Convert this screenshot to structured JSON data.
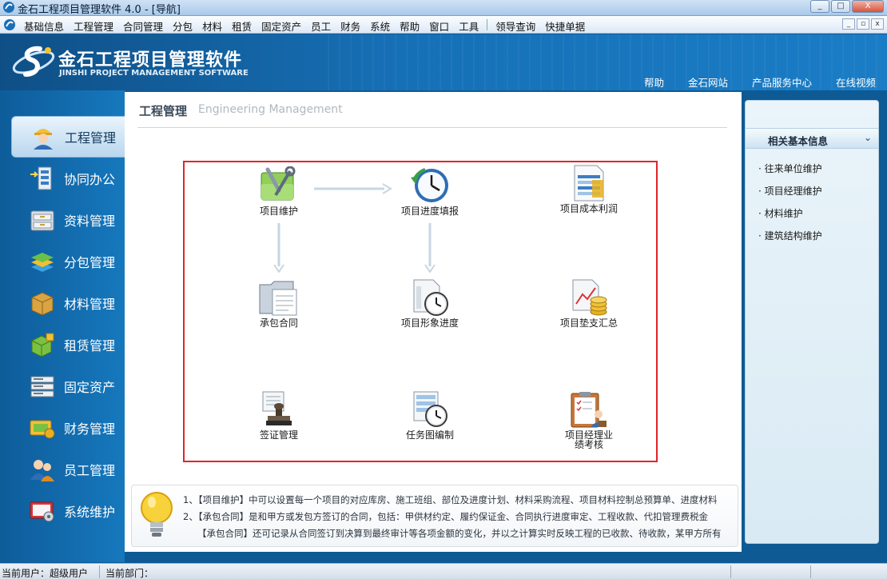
{
  "window": {
    "title": "金石工程项目管理软件 4.0 - [导航]",
    "controls": [
      "_",
      "□",
      "X"
    ]
  },
  "menubar": {
    "items": [
      "基础信息",
      "工程管理",
      "合同管理",
      "分包",
      "材料",
      "租赁",
      "固定资产",
      "员工",
      "财务",
      "系统",
      "帮助",
      "窗口",
      "工具",
      "领导查询",
      "快捷单据"
    ],
    "mdi_controls": [
      "_",
      "▫",
      "x"
    ]
  },
  "banner": {
    "logo_cn": "金石工程项目管理软件",
    "logo_en": "JINSHI PROJECT MANAGEMENT SOFTWARE",
    "links": [
      "帮助",
      "金石网站",
      "产品服务中心",
      "在线视频"
    ]
  },
  "nav": {
    "items": [
      {
        "label": "工程管理",
        "icon": "engineer-icon"
      },
      {
        "label": "协同办公",
        "icon": "office-icon"
      },
      {
        "label": "资料管理",
        "icon": "archive-icon"
      },
      {
        "label": "分包管理",
        "icon": "subcontract-icon"
      },
      {
        "label": "材料管理",
        "icon": "material-box-icon"
      },
      {
        "label": "租赁管理",
        "icon": "lease-icon"
      },
      {
        "label": "固定资产",
        "icon": "server-rack-icon"
      },
      {
        "label": "财务管理",
        "icon": "finance-icon"
      },
      {
        "label": "员工管理",
        "icon": "staff-icon"
      },
      {
        "label": "系统维护",
        "icon": "system-icon"
      }
    ],
    "active": "工程管理"
  },
  "main": {
    "title": "工程管理",
    "subtitle": "Engineering Management",
    "workflow": {
      "project_maintain": "项目维护",
      "progress_fill": "项目进度填报",
      "cost_profit": "项目成本利润",
      "contract": "承包合同",
      "visual_progress": "项目形象进度",
      "advance_summary": "项目垫支汇总",
      "visa": "签证管理",
      "task_chart": "任务图编制",
      "pm_eval_1": "项目经理业",
      "pm_eval_2": "绩考核"
    },
    "tips": [
      "1、【项目维护】中可以设置每一个项目的对应库房、施工班组、部位及进度计划、材料采购流程、项目材料控制总预算单、进度材料",
      "2、【承包合同】是和甲方或发包方签订的合同，包括：甲供材约定、履约保证金、合同执行进度审定、工程收款、代扣管理费税金",
      "【承包合同】还可记录从合同签订到决算到最终审计等各项金额的变化，并以之计算实时反映工程的已收款、待收款，某甲方所有"
    ]
  },
  "rightpanel": {
    "title": "相关基本信息",
    "toggle": "⌄",
    "links": [
      "· 往来单位维护",
      "· 项目经理维护",
      "· 材料维护",
      "· 建筑结构维护"
    ]
  },
  "status": {
    "user": "当前用户：超级用户",
    "dept": "当前部门："
  },
  "colors": {
    "accent": "#1670b6",
    "highlight_border": "#e0242a"
  }
}
